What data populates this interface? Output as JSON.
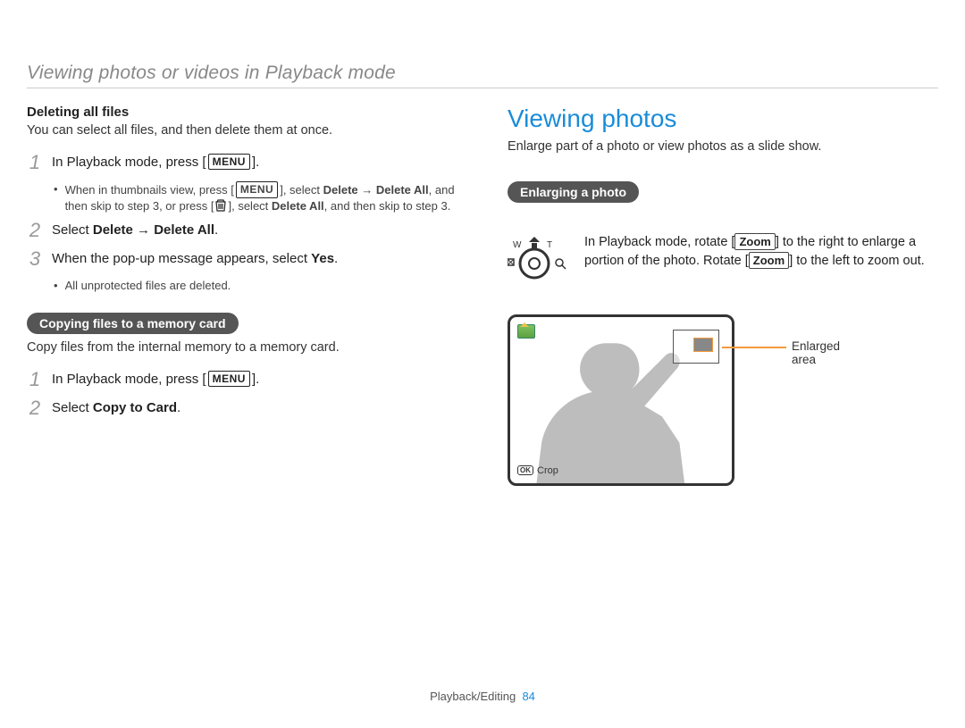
{
  "header": {
    "title": "Viewing photos or videos in Playback mode"
  },
  "left": {
    "deleting_heading": "Deleting all files",
    "deleting_intro": "You can select all files, and then delete them at once.",
    "menu_label": "MENU",
    "step1_pre": "In Playback mode, press [",
    "step1_post": "].",
    "step1_bullet_a": "When in thumbnails view, press [",
    "step1_bullet_b": "], select ",
    "step1_bullet_bold": "Delete → Delete All",
    "step1_bullet_c": ", and then skip to step 3, or press [",
    "step1_bullet_d": "], select ",
    "step1_bullet_bold2": "Delete All",
    "step1_bullet_e": ", and then skip to step 3.",
    "step2_a": "Select ",
    "step2_bold": "Delete → Delete All",
    "step2_b": ".",
    "step3_a": "When the pop-up message appears, select ",
    "step3_bold": "Yes",
    "step3_b": ".",
    "step3_bullet": "All unprotected files are deleted.",
    "copy_pill": "Copying files to a memory card",
    "copy_intro": "Copy files from the internal memory to a memory card.",
    "copy_step1_pre": "In Playback mode, press [",
    "copy_step1_post": "].",
    "copy_step2_a": "Select ",
    "copy_step2_bold": "Copy to Card",
    "copy_step2_b": "."
  },
  "right": {
    "title": "Viewing photos",
    "intro": "Enlarge part of a photo or view photos as a slide show.",
    "enlarge_pill": "Enlarging a photo",
    "enlarge_a": "In Playback mode, rotate [",
    "zoom_label": "Zoom",
    "enlarge_b": "] to the right to enlarge a portion of the photo. Rotate [",
    "enlarge_c": "] to the left to zoom out.",
    "callout_label": "Enlarged area",
    "ok_label": "OK",
    "crop_label": "Crop",
    "dial_w": "W",
    "dial_t": "T"
  },
  "footer": {
    "section": "Playback/Editing",
    "page": "84"
  },
  "icons": {
    "trash": "trash-icon",
    "dial": "zoom-dial-icon",
    "picture": "picture-icon"
  }
}
